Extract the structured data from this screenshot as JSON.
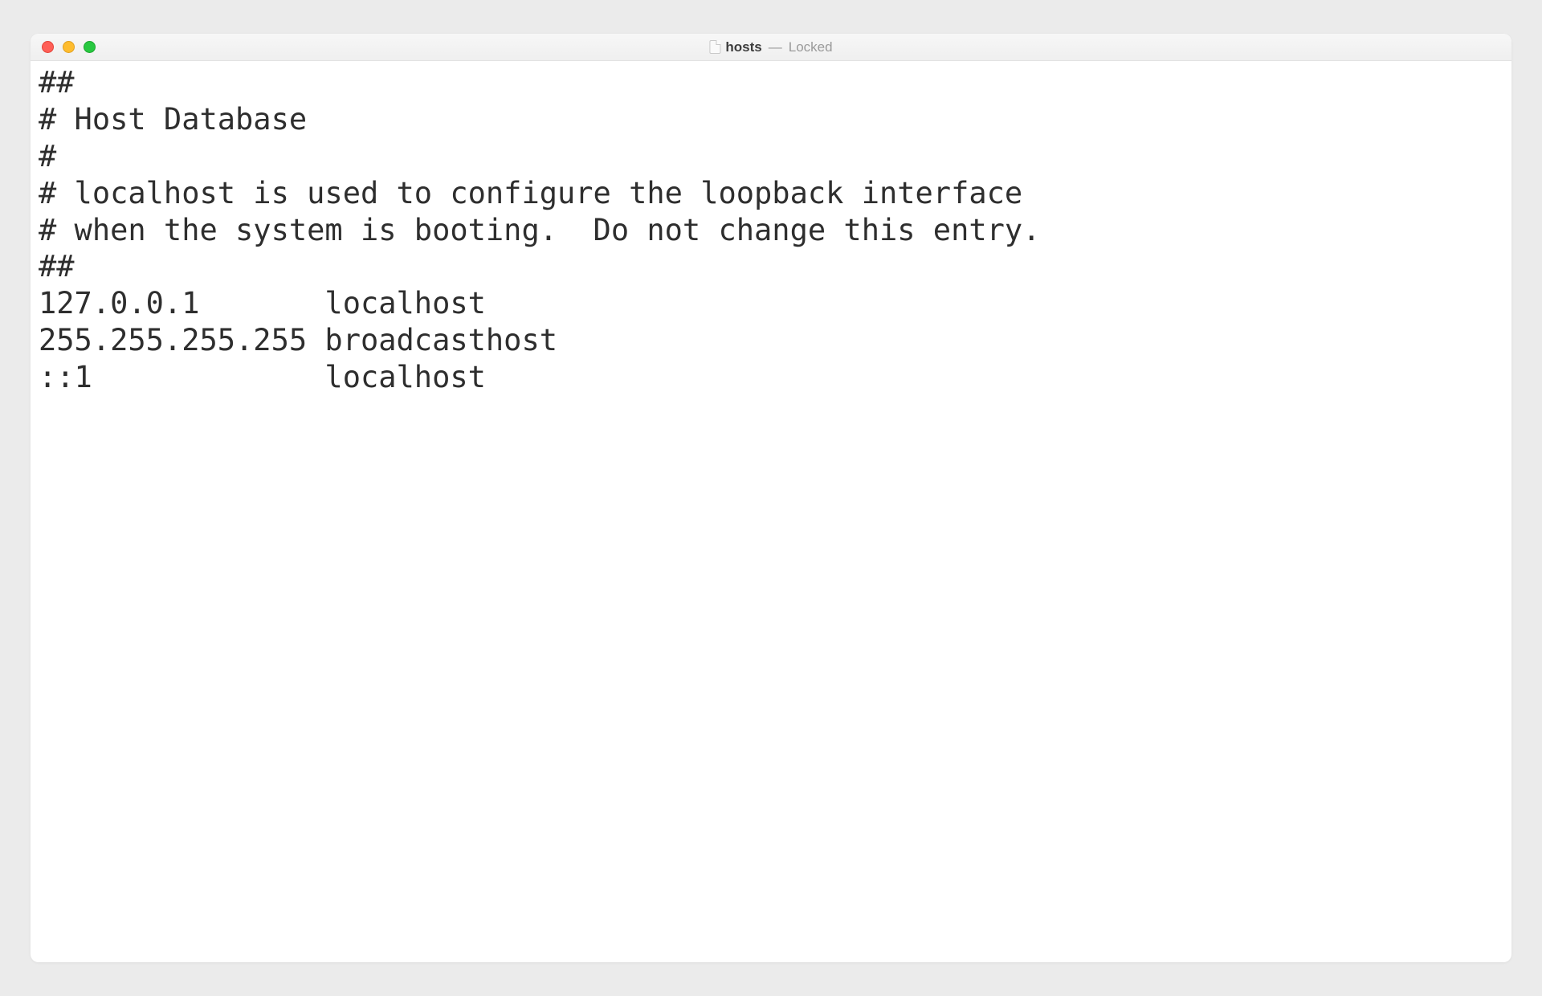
{
  "window": {
    "title": {
      "filename": "hosts",
      "separator": "—",
      "status": "Locked"
    },
    "traffic_light_colors": {
      "close": "#ff5f57",
      "minimize": "#febc2e",
      "zoom": "#28c840"
    }
  },
  "editor": {
    "lines": [
      "##",
      "# Host Database",
      "#",
      "# localhost is used to configure the loopback interface",
      "# when the system is booting.  Do not change this entry.",
      "##",
      "127.0.0.1       localhost",
      "255.255.255.255 broadcasthost",
      "::1             localhost"
    ]
  }
}
